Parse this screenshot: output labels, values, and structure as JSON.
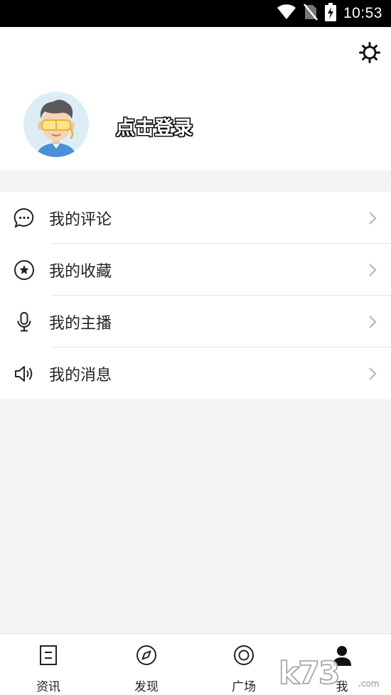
{
  "status_bar": {
    "time": "10:53",
    "icons": [
      "wifi-icon",
      "no-sim-icon",
      "battery-charging-icon"
    ]
  },
  "profile": {
    "login_text": "点击登录",
    "avatar": "avatar-illustration",
    "settings_icon": "gear-icon"
  },
  "menu": {
    "items": [
      {
        "label": "我的评论",
        "icon": "comment-icon"
      },
      {
        "label": "我的收藏",
        "icon": "star-icon"
      },
      {
        "label": "我的主播",
        "icon": "microphone-icon"
      },
      {
        "label": "我的消息",
        "icon": "speaker-icon"
      }
    ]
  },
  "bottom_nav": {
    "items": [
      {
        "label": "资讯",
        "icon": "news-icon",
        "active": false
      },
      {
        "label": "发现",
        "icon": "compass-icon",
        "active": false
      },
      {
        "label": "广场",
        "icon": "target-icon",
        "active": false
      },
      {
        "label": "我",
        "icon": "person-icon",
        "active": true
      }
    ]
  },
  "watermark": {
    "text": "k73.com"
  },
  "colors": {
    "background": "#f4f4f4",
    "surface": "#ffffff",
    "status_bar": "#000000",
    "text": "#222222",
    "divider": "#e4e4e4",
    "chevron": "#b8b8b8",
    "avatar_bg": "#dcedf6"
  }
}
